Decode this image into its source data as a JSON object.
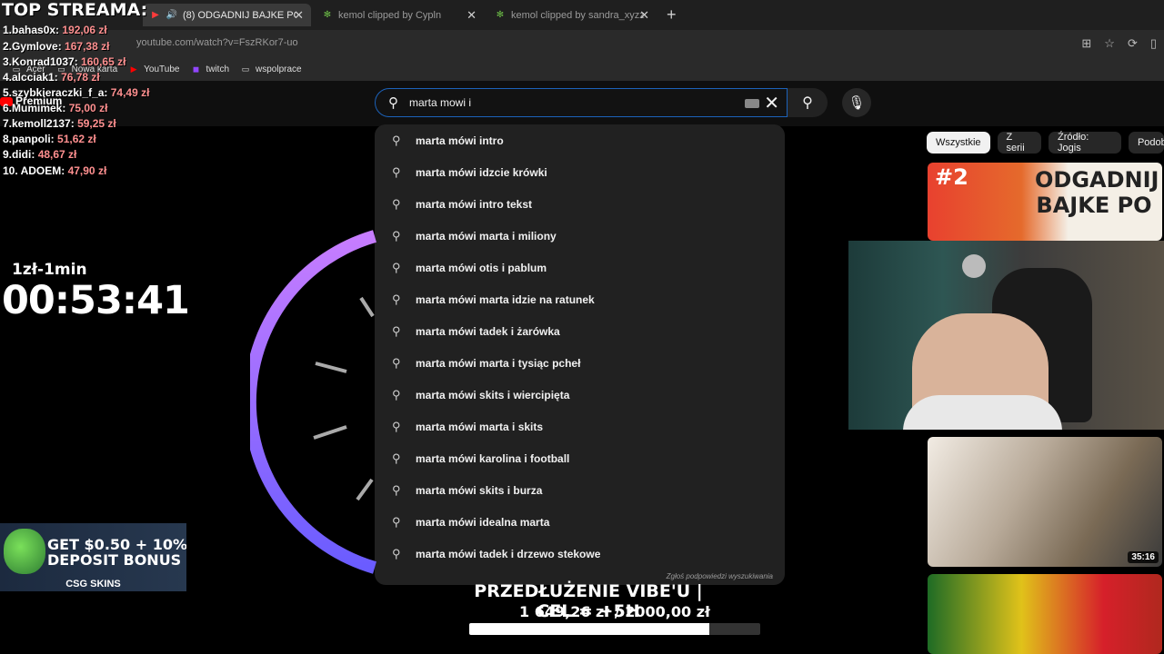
{
  "browser": {
    "tabs": [
      {
        "label": "(8) ODGADNIJ BAJKE PO PIO…",
        "active": true
      },
      {
        "label": "kemol clipped by Cypln",
        "active": false
      },
      {
        "label": "kemol clipped by sandra_xyzz",
        "active": false
      }
    ],
    "url": "youtube.com/watch?v=FszRKor7-uo",
    "bookmarks": [
      "Acer",
      "Nowa karta",
      "YouTube",
      "twitch",
      "wspolprace"
    ]
  },
  "search": {
    "value": "marta mowi i",
    "suggestions": [
      "marta mówi intro",
      "marta mówi idzcie krówki",
      "marta mówi intro tekst",
      "marta mówi marta i miliony",
      "marta mówi otis i pablum",
      "marta mówi marta idzie na ratunek",
      "marta mówi tadek i żarówka",
      "marta mówi marta i tysiąc pcheł",
      "marta mówi skits i wiercipięta",
      "marta mówi marta i skits",
      "marta mówi karolina i football",
      "marta mówi skits i burza",
      "marta mówi idealna marta",
      "marta mówi tadek i drzewo stekowe"
    ],
    "report_label": "Zgłoś podpowiedzi wyszukiwania"
  },
  "chips": [
    "Wszystkie",
    "Z serii",
    "Źródło: Jogis",
    "Podob"
  ],
  "thumbs": {
    "first_number": "#2",
    "first_title": "ODGADNIJ BAJKE PO",
    "second_duration": "35:16"
  },
  "overlay": {
    "top_title": "TOP STREAMA:",
    "leaderboard": [
      {
        "name": "1.bahas0x:",
        "amount": "192,06 zł"
      },
      {
        "name": "2.Gymlove:",
        "amount": "167,38 zł"
      },
      {
        "name": "3.Konrad1037:",
        "amount": "160,65 zł"
      },
      {
        "name": "4.alcciak1:",
        "amount": "76,78 zł"
      },
      {
        "name": "5.szybkieraczki_f_a:",
        "amount": "74,49 zł"
      },
      {
        "name": "6.Mumimek:",
        "amount": "75,00 zł"
      },
      {
        "name": "7.kemoll2137:",
        "amount": "59,25 zł"
      },
      {
        "name": "8.panpoli:",
        "amount": "51,62 zł"
      },
      {
        "name": "9.didi:",
        "amount": "48,67 zł"
      },
      {
        "name": "10. ADOEM:",
        "amount": "47,90 zł"
      }
    ],
    "premium_label": "Premium",
    "timer_rate": "1zł-1min",
    "timer": "00:53:41",
    "bonus_line1": "GET $0.50 + 10%",
    "bonus_line2": "DEPOSIT BONUS",
    "bonus_brand": "CSG SKINS",
    "goal_title": "PRZEDŁUŻENIE VIBE'U | CEL = +5H",
    "goal_value": "1 649,26 zł / 2000,00 zł",
    "goal_fraction": 0.8246
  },
  "colors": {
    "accent_blue": "#1c62b9",
    "ring_start": "#c77dff",
    "ring_end": "#6a5cff",
    "amount_red": "#ff9090"
  }
}
